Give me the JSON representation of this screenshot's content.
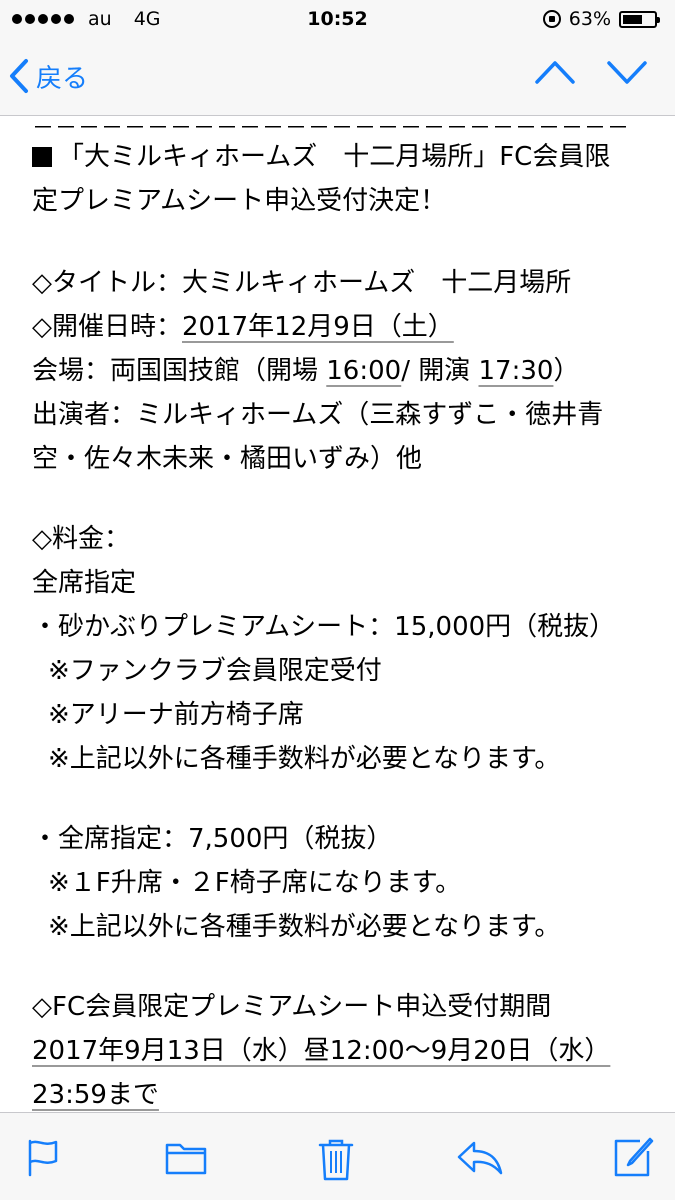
{
  "status_bar": {
    "carrier": "au",
    "network": "4G",
    "time": "10:52",
    "battery_percent_text": "63%",
    "battery_level": 0.63
  },
  "nav": {
    "back_label": "戻る",
    "accent_color": "#157efb"
  },
  "email": {
    "separator": "－－－－－－－－－－－－－－－－－－－－－－－－－－",
    "lines": [
      "「大ミルキィホームズ　十二月場所」FC会員限",
      "定プレミアムシート申込受付決定！",
      "◇タイトル：大ミルキィホームズ　十二月場所",
      "◇開催日時：",
      "2017年12月9日（土）",
      "会場：両国国技館（開場 ",
      "16:00",
      "/ 開演 ",
      "17:30",
      "）",
      "出演者：ミルキィホームズ（三森すずこ・徳井青",
      "空・佐々木未来・橘田いずみ）他",
      "◇料金：",
      "全席指定",
      "・砂かぶりプレミアムシート：15,000円（税抜）",
      "※ファンクラブ会員限定受付",
      "※アリーナ前方椅子席",
      "※上記以外に各種手数料が必要となります。",
      "・全席指定：7,500円（税抜）",
      "※１F升席・２F椅子席になります。",
      "※上記以外に各種手数料が必要となります。",
      "◇FC会員限定プレミアムシート申込受付期間",
      "2017年9月13日（水）昼12:00～9月20日（水）",
      "23:59まで"
    ]
  },
  "toolbar": {
    "icons": [
      "flag-icon",
      "folder-icon",
      "trash-icon",
      "reply-icon",
      "compose-icon"
    ]
  }
}
